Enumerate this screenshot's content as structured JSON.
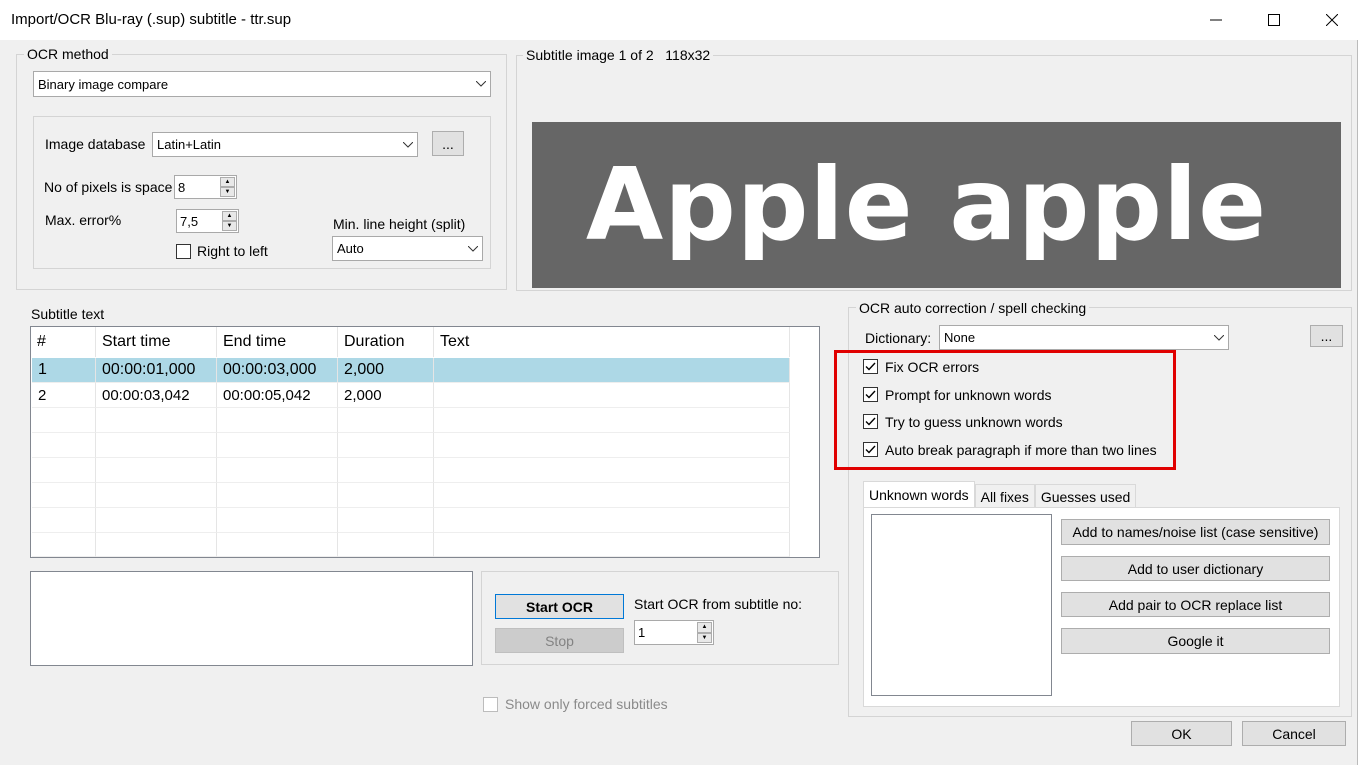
{
  "window": {
    "title": "Import/OCR Blu-ray (.sup) subtitle - ttr.sup",
    "minimize": "—",
    "maximize": "☐",
    "close": "✕"
  },
  "ocr_method": {
    "legend": "OCR method",
    "method_value": "Binary image compare",
    "image_db_label": "Image database",
    "image_db_value": "Latin+Latin",
    "browse_label": "...",
    "pixels_label": "No of pixels is space",
    "pixels_value": "8",
    "max_error_label": "Max. error%",
    "max_error_value": "7,5",
    "rtl_label": "Right to left",
    "rtl_checked": false,
    "min_line_label": "Min. line height (split)",
    "min_line_value": "Auto"
  },
  "subtitle_image": {
    "legend": "Subtitle image 1 of 2   118x32",
    "preview_text": "Apple apple",
    "bg_color": "#666666",
    "text_color": "#ffffff"
  },
  "subtitle_text": {
    "legend": "Subtitle text",
    "columns": [
      "#",
      "Start time",
      "End time",
      "Duration",
      "Text"
    ],
    "rows": [
      {
        "num": "1",
        "start": "00:00:01,000",
        "end": "00:00:03,000",
        "duration": "2,000",
        "text": "",
        "selected": true
      },
      {
        "num": "2",
        "start": "00:00:03,042",
        "end": "00:00:05,042",
        "duration": "2,000",
        "text": "",
        "selected": false
      }
    ],
    "selected_color": "#add8e6"
  },
  "ocr_controls": {
    "start_label": "Start OCR",
    "stop_label": "Stop",
    "from_label": "Start OCR from subtitle no:",
    "from_value": "1",
    "forced_label": "Show only forced subtitles"
  },
  "auto_correction": {
    "legend": "OCR auto correction / spell checking",
    "dictionary_label": "Dictionary:",
    "dictionary_value": "None",
    "browse_label": "...",
    "options": [
      {
        "label": "Fix OCR errors",
        "checked": true
      },
      {
        "label": "Prompt for unknown words",
        "checked": true
      },
      {
        "label": "Try to guess unknown words",
        "checked": true
      },
      {
        "label": "Auto break paragraph if more than two lines",
        "checked": true
      }
    ],
    "highlight_color": "#e00000",
    "tabs": [
      "Unknown words",
      "All fixes",
      "Guesses used"
    ],
    "buttons": [
      "Add to names/noise list (case sensitive)",
      "Add to user dictionary",
      "Add pair to OCR replace list",
      "Google it"
    ]
  },
  "footer": {
    "ok_label": "OK",
    "cancel_label": "Cancel"
  }
}
